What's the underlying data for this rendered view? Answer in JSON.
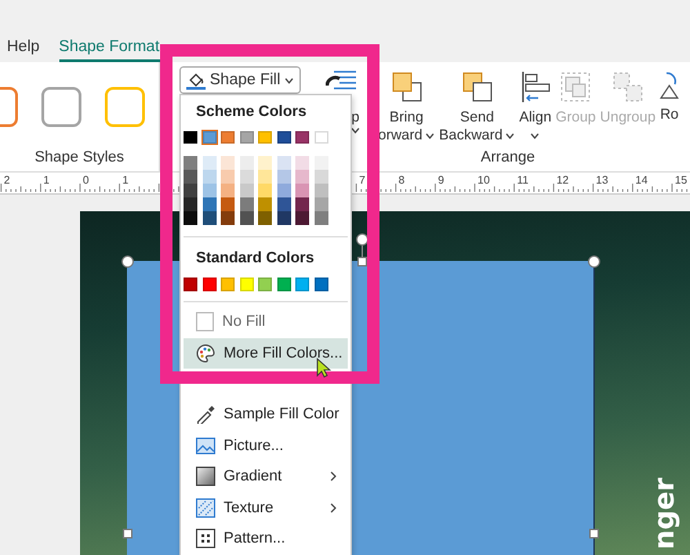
{
  "tabs": [
    {
      "label": "Help",
      "selected": false
    },
    {
      "label": "Shape Format",
      "selected": true
    }
  ],
  "ribbon": {
    "shape_styles": {
      "label": "Shape Styles",
      "swatches": [
        {
          "color": "#ed7d31"
        },
        {
          "color": "#a5a5a5"
        },
        {
          "color": "#ffc000"
        }
      ]
    },
    "shape_fill_button": {
      "label": "Shape Fill"
    },
    "arrange": {
      "label": "Arrange",
      "items": [
        {
          "kind": "wrap",
          "lines": [
            "p"
          ],
          "dropdown": true,
          "disabled": false
        },
        {
          "kind": "bring",
          "lines": [
            "Bring",
            "orward"
          ],
          "dropdown": true,
          "disabled": false
        },
        {
          "kind": "send",
          "lines": [
            "Send",
            "Backward"
          ],
          "dropdown": true,
          "disabled": false
        },
        {
          "kind": "align",
          "lines": [
            "Align"
          ],
          "dropdown": true,
          "disabled": false
        },
        {
          "kind": "group",
          "lines": [
            "Group"
          ],
          "dropdown": false,
          "disabled": true
        },
        {
          "kind": "ungroup",
          "lines": [
            "Ungroup"
          ],
          "dropdown": false,
          "disabled": true
        },
        {
          "kind": "rotate",
          "lines": [
            "Ro"
          ],
          "dropdown": false,
          "disabled": false
        }
      ]
    }
  },
  "ruler": {
    "left_labels": [
      "2",
      "1",
      "0",
      "1"
    ],
    "right_labels": [
      "7",
      "8",
      "9",
      "10",
      "11",
      "12",
      "13",
      "14",
      "15"
    ]
  },
  "fill_menu": {
    "scheme_title": "Scheme Colors",
    "scheme_colors": [
      {
        "color": "#000000",
        "selected": false,
        "shades": [
          {
            "color": "#7f7f7f"
          },
          {
            "color": "#595959"
          },
          {
            "color": "#404040"
          },
          {
            "color": "#262626"
          },
          {
            "color": "#0d0d0d"
          }
        ]
      },
      {
        "color": "#5b9bd5",
        "selected": true,
        "shades": [
          {
            "color": "#deebf7"
          },
          {
            "color": "#bdd7ee"
          },
          {
            "color": "#9dc3e6"
          },
          {
            "color": "#2e75b6"
          },
          {
            "color": "#1f4e79"
          }
        ]
      },
      {
        "color": "#ed7d31",
        "selected": false,
        "shades": [
          {
            "color": "#fbe5d6"
          },
          {
            "color": "#f8cbad"
          },
          {
            "color": "#f4b183"
          },
          {
            "color": "#c55a11"
          },
          {
            "color": "#843c0c"
          }
        ]
      },
      {
        "color": "#a5a5a5",
        "selected": false,
        "shades": [
          {
            "color": "#ededed"
          },
          {
            "color": "#dbdbdb"
          },
          {
            "color": "#c9c9c9"
          },
          {
            "color": "#7c7c7c"
          },
          {
            "color": "#525252"
          }
        ]
      },
      {
        "color": "#ffc000",
        "selected": false,
        "shades": [
          {
            "color": "#fff2cc"
          },
          {
            "color": "#ffe699"
          },
          {
            "color": "#ffd966"
          },
          {
            "color": "#bf9000"
          },
          {
            "color": "#7f6000"
          }
        ]
      },
      {
        "color": "#1f4e99",
        "selected": false,
        "shades": [
          {
            "color": "#dae3f3"
          },
          {
            "color": "#b4c7e7"
          },
          {
            "color": "#8faadc"
          },
          {
            "color": "#2f5597"
          },
          {
            "color": "#203864"
          }
        ]
      },
      {
        "color": "#993366",
        "selected": false,
        "shades": [
          {
            "color": "#f2dce6"
          },
          {
            "color": "#e6b8cc"
          },
          {
            "color": "#d994b3"
          },
          {
            "color": "#73264d"
          },
          {
            "color": "#4d1933"
          }
        ]
      },
      {
        "color": "#ffffff",
        "selected": false,
        "shades": [
          {
            "color": "#f2f2f2"
          },
          {
            "color": "#d9d9d9"
          },
          {
            "color": "#bfbfbf"
          },
          {
            "color": "#a6a6a6"
          },
          {
            "color": "#7f7f7f"
          }
        ]
      }
    ],
    "standard_title": "Standard Colors",
    "standard_colors": [
      {
        "color": "#c00000"
      },
      {
        "color": "#ff0000"
      },
      {
        "color": "#ffc000"
      },
      {
        "color": "#ffff00"
      },
      {
        "color": "#92d050"
      },
      {
        "color": "#00b050"
      },
      {
        "color": "#00b0f0"
      },
      {
        "color": "#0070c0"
      }
    ],
    "items": [
      {
        "kind": "no_fill",
        "label": "No Fill",
        "selected": false,
        "submenu": false
      },
      {
        "kind": "more_colors",
        "label": "More Fill Colors...",
        "selected": true,
        "submenu": false
      },
      {
        "kind": "sample",
        "label": "Sample Fill Color",
        "selected": false,
        "submenu": false
      },
      {
        "kind": "picture",
        "label": "Picture...",
        "selected": false,
        "submenu": false
      },
      {
        "kind": "gradient",
        "label": "Gradient",
        "selected": false,
        "submenu": true
      },
      {
        "kind": "texture",
        "label": "Texture",
        "selected": false,
        "submenu": true
      },
      {
        "kind": "pattern",
        "label": "Pattern...",
        "selected": false,
        "submenu": false
      }
    ]
  },
  "slide": {
    "vertical_text": "nger"
  }
}
